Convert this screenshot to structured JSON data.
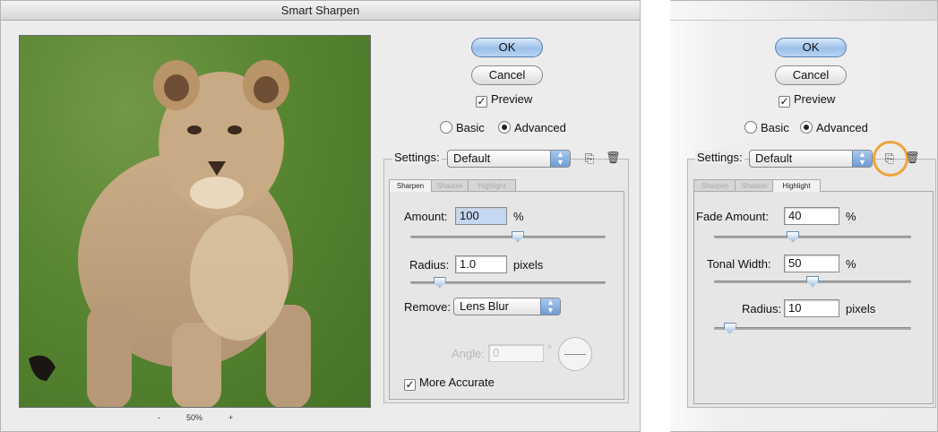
{
  "left_dialog": {
    "title": "Smart Sharpen",
    "buttons": {
      "ok": "OK",
      "cancel": "Cancel"
    },
    "preview_label": "Preview",
    "preview_checked": true,
    "mode": {
      "basic": "Basic",
      "advanced": "Advanced",
      "selected": "Advanced"
    },
    "settings": {
      "label": "Settings:",
      "value": "Default"
    },
    "tabs": [
      "Sharpen",
      "Shadow",
      "Highlight"
    ],
    "active_tab": "Sharpen",
    "amount": {
      "label": "Amount:",
      "value": "100",
      "unit": "%",
      "slider_percent": 55
    },
    "radius": {
      "label": "Radius:",
      "value": "1.0",
      "unit": "pixels",
      "slider_percent": 15
    },
    "remove": {
      "label": "Remove:",
      "value": "Lens Blur"
    },
    "angle": {
      "label": "Angle:",
      "value": "0",
      "unit": "°"
    },
    "more_accurate": {
      "label": "More Accurate",
      "checked": true
    },
    "zoom": {
      "minus": "-",
      "level": "50%",
      "plus": "+"
    }
  },
  "right_dialog": {
    "buttons": {
      "ok": "OK",
      "cancel": "Cancel"
    },
    "preview_label": "Preview",
    "preview_checked": true,
    "mode": {
      "basic": "Basic",
      "advanced": "Advanced",
      "selected": "Advanced"
    },
    "settings": {
      "label": "Settings:",
      "value": "Default"
    },
    "tabs": [
      "Sharpen",
      "Shadow",
      "Highlight"
    ],
    "active_tab": "Highlight",
    "fade_amount": {
      "label": "Fade Amount:",
      "value": "40",
      "unit": "%",
      "slider_percent": 40
    },
    "tonal_width": {
      "label": "Tonal Width:",
      "value": "50",
      "unit": "%",
      "slider_percent": 50
    },
    "radius": {
      "label": "Radius:",
      "value": "10",
      "unit": "pixels",
      "slider_percent": 8
    }
  },
  "colors": {
    "accent_ring": "#f0a43a",
    "default_button": "#9cc0e9"
  }
}
